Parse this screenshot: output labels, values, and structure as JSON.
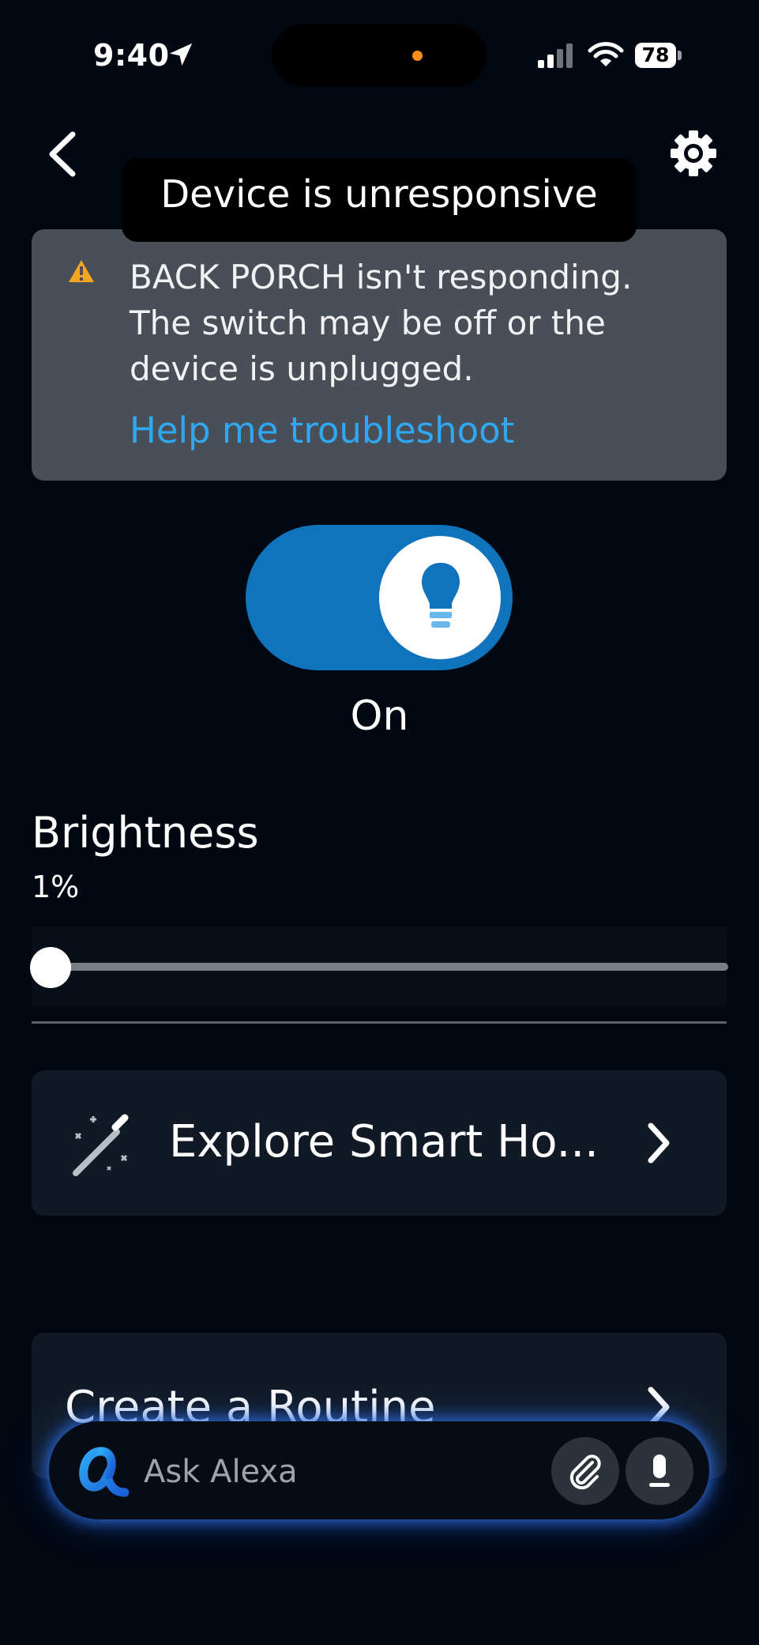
{
  "status_bar": {
    "time": "9:40",
    "battery": "78"
  },
  "header": {
    "tooltip": "Device is unresponsive"
  },
  "warning": {
    "message": "BACK PORCH isn't responding. The switch may be off or the device is unplugged.",
    "link": "Help me troubleshoot",
    "icon": "warning-triangle-icon",
    "icon_color": "#f5a623",
    "link_color": "#2ea8f2"
  },
  "power": {
    "state_label": "On",
    "toggle_color": "#1074bd",
    "icon": "light-bulb-icon"
  },
  "brightness": {
    "title": "Brightness",
    "value_label": "1%",
    "value": 1
  },
  "cards": {
    "explore_label": "Explore Smart Ho...",
    "routine_label": "Create a Routine"
  },
  "alexa_bar": {
    "placeholder": "Ask Alexa",
    "logo_color": "#2ea8f2"
  }
}
